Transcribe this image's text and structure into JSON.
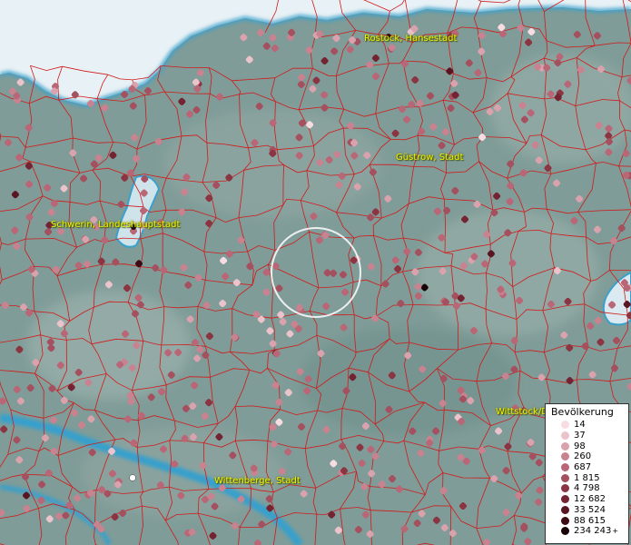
{
  "map": {
    "labels": [
      {
        "key": "rostock",
        "text": "Rostock, Hansestadt"
      },
      {
        "key": "guestrow",
        "text": "Güstrow, Stadt"
      },
      {
        "key": "schwerin",
        "text": "Schwerin, Landeshauptstadt"
      },
      {
        "key": "wittstock",
        "text": "Wittstock/D"
      },
      {
        "key": "wittenberge",
        "text": "Wittenberge, Stadt"
      }
    ],
    "colors": {
      "land": "#7f9c98",
      "sea": "#e6f0f4",
      "water": "#3aa0cc",
      "borders": "#d11a1a"
    }
  },
  "legend": {
    "title": "Bevölkerung",
    "classes": [
      {
        "label": "14",
        "color": "#f7dde2"
      },
      {
        "label": "37",
        "color": "#ebc3cb"
      },
      {
        "label": "98",
        "color": "#d9a2ad"
      },
      {
        "label": "260",
        "color": "#c98290"
      },
      {
        "label": "687",
        "color": "#b96676"
      },
      {
        "label": "1 815",
        "color": "#a4505f"
      },
      {
        "label": "4 798",
        "color": "#8b3442"
      },
      {
        "label": "12 682",
        "color": "#732331"
      },
      {
        "label": "33 524",
        "color": "#5a1522"
      },
      {
        "label": "88 615",
        "color": "#3e0a13"
      },
      {
        "label": "234 243",
        "color": "#1a0306",
        "plus": "+"
      }
    ]
  }
}
